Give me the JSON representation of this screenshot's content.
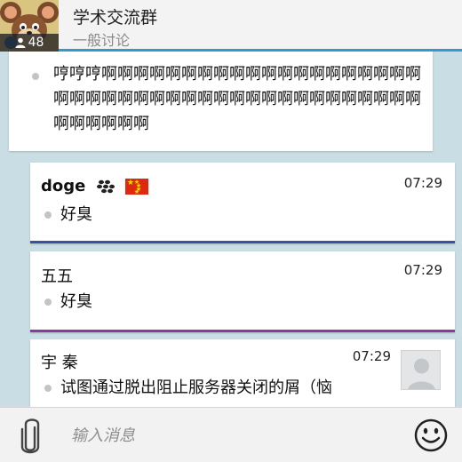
{
  "header": {
    "group_title": "学术交流群",
    "group_subtitle": "一般讨论",
    "member_count": "48"
  },
  "messages": [
    {
      "sender": "",
      "time": "",
      "text": "哼哼哼啊啊啊啊啊啊啊啊啊啊啊啊啊啊啊啊啊啊啊啊啊啊啊啊啊啊啊啊啊啊啊啊啊啊啊啊啊啊啊啊啊啊啊啊啊啊啊啊啊"
    },
    {
      "sender": "doge",
      "time": "07:29",
      "text": "好臭",
      "accent_color": "#3d4fa3"
    },
    {
      "sender": "五五",
      "time": "07:29",
      "text": "好臭",
      "accent_color": "#8a3b9a"
    },
    {
      "sender": "宇 秦",
      "time": "07:29",
      "text": "试图通过脱出阻止服务器关闭的屑（恼"
    }
  ],
  "input": {
    "placeholder": "输入消息"
  },
  "icons": {
    "attach": "paperclip-icon",
    "emoji": "smiley-icon",
    "members": "person-icon",
    "messenger": "blackberry-icon",
    "flag": "china-flag-icon"
  },
  "colors": {
    "header_accent": "#2f9ad0",
    "background": "#c9dde4"
  }
}
